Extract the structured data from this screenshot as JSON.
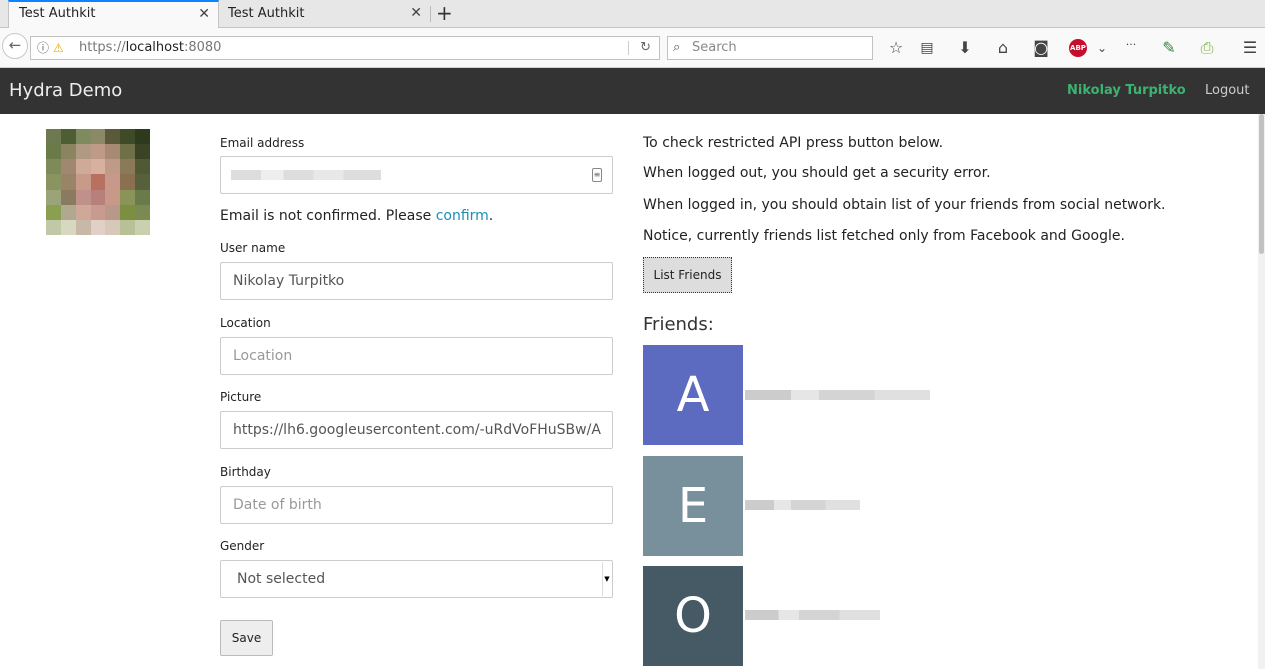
{
  "browser": {
    "tabs": [
      {
        "title": "Test Authkit",
        "active": true
      },
      {
        "title": "Test Authkit",
        "active": false
      }
    ],
    "url": {
      "scheme": "https://",
      "host": "localhost",
      "port": ":8080"
    },
    "search_placeholder": "Search",
    "abp_label": "ABP"
  },
  "app": {
    "brand": "Hydra Demo",
    "user_name": "Nikolay Turpitko",
    "logout_label": "Logout"
  },
  "profile": {
    "email_label": "Email address",
    "email_notice_prefix": "Email is not confirmed. Please ",
    "email_confirm_link": "confirm",
    "email_notice_suffix": ".",
    "username_label": "User name",
    "username_value": "Nikolay Turpitko",
    "location_label": "Location",
    "location_placeholder": "Location",
    "picture_label": "Picture",
    "picture_value": "https://lh6.googleusercontent.com/-uRdVoFHuSBw/A",
    "birthday_label": "Birthday",
    "birthday_placeholder": "Date of birth",
    "gender_label": "Gender",
    "gender_selected": "Not selected",
    "save_label": "Save"
  },
  "friends_panel": {
    "lines": [
      "To check restricted API press button below.",
      "When logged out, you should get a security error.",
      "When logged in, you should obtain list of your friends from social network.",
      "Notice, currently friends list fetched only from Facebook and Google."
    ],
    "list_button_label": "List Friends",
    "title": "Friends:",
    "friends": [
      {
        "initial": "A",
        "color": "#5c6bc0"
      },
      {
        "initial": "E",
        "color": "#78909c"
      },
      {
        "initial": "O",
        "color": "#455a64"
      }
    ]
  },
  "colors": {
    "appbar": "#333333",
    "user_link": "#3cb371",
    "link": "#1a8fb3",
    "tab_accent": "#0a84ff"
  }
}
